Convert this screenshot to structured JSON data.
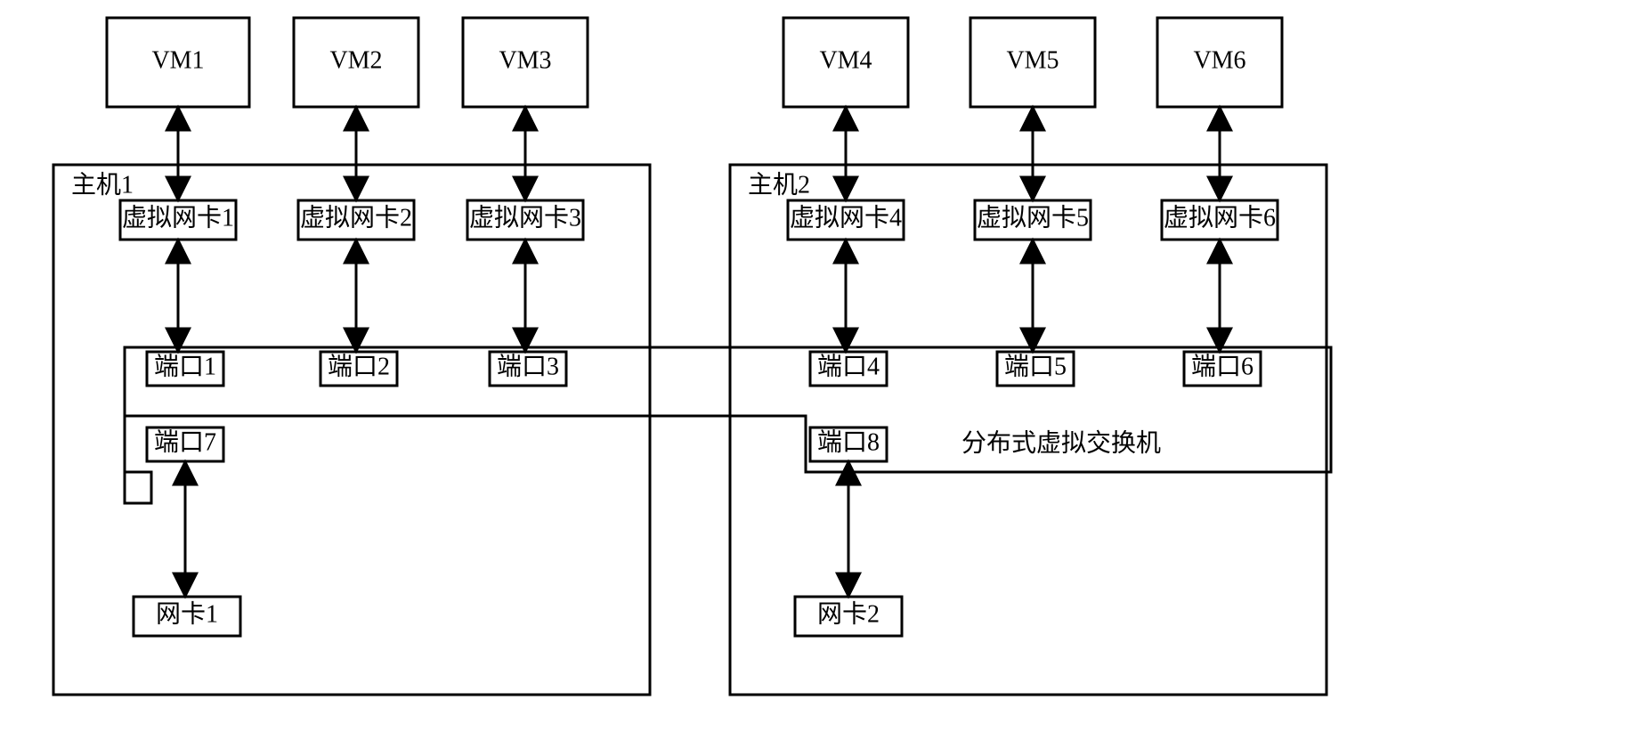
{
  "host1": {
    "label": "主机1"
  },
  "host2": {
    "label": "主机2"
  },
  "vm": {
    "1": "VM1",
    "2": "VM2",
    "3": "VM3",
    "4": "VM4",
    "5": "VM5",
    "6": "VM6"
  },
  "vnic": {
    "1": "虚拟网卡1",
    "2": "虚拟网卡2",
    "3": "虚拟网卡3",
    "4": "虚拟网卡4",
    "5": "虚拟网卡5",
    "6": "虚拟网卡6"
  },
  "port": {
    "1": "端口1",
    "2": "端口2",
    "3": "端口3",
    "4": "端口4",
    "5": "端口5",
    "6": "端口6",
    "7": "端口7",
    "8": "端口8"
  },
  "nic": {
    "1": "网卡1",
    "2": "网卡2"
  },
  "dvs": "分布式虚拟交换机"
}
